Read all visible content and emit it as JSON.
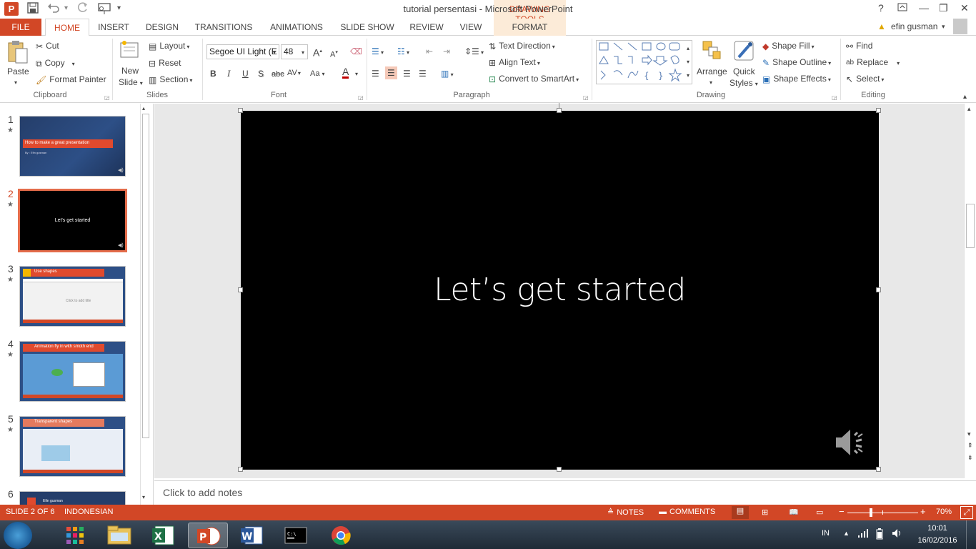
{
  "window": {
    "title": "tutorial persentasi - Microsoft PowerPoint",
    "app_logo": "P",
    "context_tab_group": "DRAWING TOOLS",
    "controls": {
      "help": "?",
      "ribbon_display": "⊡",
      "minimize": "—",
      "restore": "❐",
      "close": "✕"
    }
  },
  "quick_access": {
    "save_icon": "save-icon",
    "undo_icon": "undo-icon",
    "redo_icon": "redo-icon",
    "start_from_beginning_icon": "slideshow-icon",
    "customize_icon": "dropdown-icon"
  },
  "tabs": [
    "FILE",
    "HOME",
    "INSERT",
    "DESIGN",
    "TRANSITIONS",
    "ANIMATIONS",
    "SLIDE SHOW",
    "REVIEW",
    "VIEW",
    "FORMAT"
  ],
  "active_tab": "HOME",
  "user": {
    "name": "efin gusman",
    "warning_icon": "warning-icon"
  },
  "ribbon": {
    "clipboard": {
      "label": "Clipboard",
      "paste": "Paste",
      "cut": "Cut",
      "copy": "Copy",
      "format_painter": "Format Painter"
    },
    "slides": {
      "label": "Slides",
      "new_slide": "New",
      "new_slide_2": "Slide",
      "layout": "Layout",
      "reset": "Reset",
      "section": "Section"
    },
    "font": {
      "label": "Font",
      "font_name": "Segoe UI Light (E",
      "font_size": "48",
      "grow": "A",
      "shrink": "A",
      "bold": "B",
      "italic": "I",
      "underline": "U",
      "shadow": "S",
      "strike": "abc",
      "spacing": "AV",
      "case": "Aa",
      "font_color": "A"
    },
    "paragraph": {
      "label": "Paragraph",
      "text_direction": "Text Direction",
      "align_text": "Align Text",
      "convert_smartart": "Convert to SmartArt"
    },
    "drawing": {
      "label": "Drawing",
      "arrange": "Arrange",
      "quick_styles": "Quick",
      "quick_styles_2": "Styles",
      "shape_fill": "Shape Fill",
      "shape_outline": "Shape Outline",
      "shape_effects": "Shape Effects"
    },
    "editing": {
      "label": "Editing",
      "find": "Find",
      "replace": "Replace",
      "select": "Select"
    }
  },
  "slides": [
    {
      "num": "1",
      "title": "How to make a great presentation",
      "subtitle": "By : Efin gusman"
    },
    {
      "num": "2",
      "title": "Let's get started"
    },
    {
      "num": "3",
      "title": "Use shapes",
      "body": "Click to add title"
    },
    {
      "num": "4",
      "title": "Animation fly in with smoth end"
    },
    {
      "num": "5",
      "title": "Transparent shapes"
    },
    {
      "num": "6",
      "title": "Efin gusman"
    }
  ],
  "current_slide": {
    "title": "Let’s get started",
    "audio_icon": "speaker-icon"
  },
  "notes": {
    "placeholder": "Click to add notes"
  },
  "status": {
    "slide_info": "SLIDE 2 OF 6",
    "language": "INDONESIAN",
    "notes": "NOTES",
    "comments": "COMMENTS",
    "zoom": "70%",
    "zoom_minus": "−",
    "zoom_plus": "+",
    "zoom_level": 0.7
  },
  "taskbar": {
    "apps": [
      "start-button",
      "apps-launcher",
      "file-explorer",
      "excel",
      "powerpoint",
      "word",
      "command-prompt",
      "chrome"
    ],
    "language": "IN",
    "time": "10:01",
    "date": "16/02/2016"
  },
  "colors": {
    "accent": "#d24726",
    "slide_bg": "#000000",
    "context_tab_bg": "#fcebd8"
  }
}
